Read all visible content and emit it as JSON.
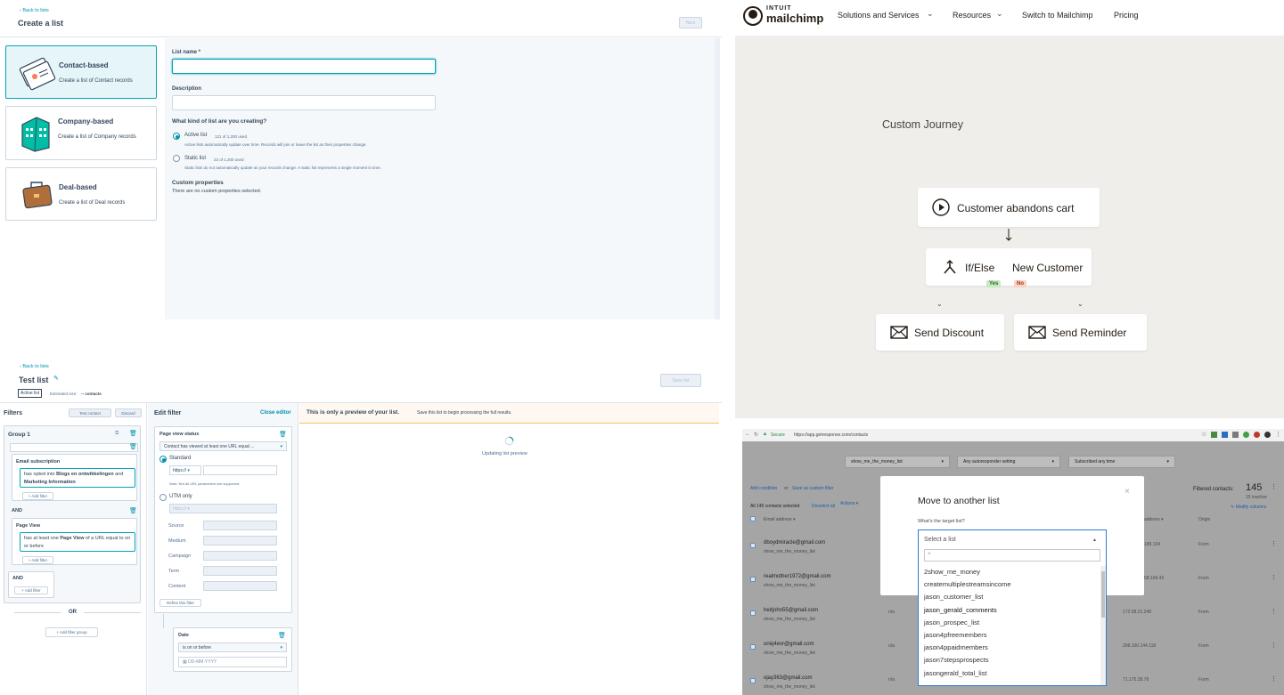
{
  "q1": {
    "back": "‹ Back to lists",
    "title": "Create a list",
    "next": "Next",
    "cards": [
      {
        "name": "Contact-based",
        "desc": "Create a list of Contact records",
        "icon": "contact-cards-icon"
      },
      {
        "name": "Company-based",
        "desc": "Create a list of Company records",
        "icon": "building-icon"
      },
      {
        "name": "Deal-based",
        "desc": "Create a list of Deal records",
        "icon": "briefcase-icon"
      }
    ],
    "list_name_label": "List name *",
    "list_name_value": "",
    "description_label": "Description",
    "description_value": "",
    "kind_question": "What kind of list are you creating?",
    "active_label": "Active list",
    "active_usage": "121 of 1,200 used",
    "active_help": "Active lists automatically update over time. Records will join or leave the list as their properties change.",
    "static_label": "Static list",
    "static_usage": "22 of 1,200 used",
    "static_help": "Static lists do not automatically update as your records change. A static list represents a single moment in time.",
    "custom_props_label": "Custom properties",
    "custom_props_text": "There are no custom properties selected.",
    "accent": "#00a4bd"
  },
  "q2": {
    "brand_top": "INTUIT",
    "brand": "mailchimp",
    "nav": [
      "Solutions and Services",
      "Resources",
      "Switch to Mailchimp",
      "Pricing"
    ],
    "journey_title": "Custom Journey",
    "trigger": "Customer abandons cart",
    "branch": "If/Else",
    "branch_cond": "New Customer",
    "yes": "Yes",
    "no": "No",
    "left_action": "Send Discount",
    "right_action": "Send Reminder",
    "bg": "#efeeea"
  },
  "q3": {
    "back": "‹ Back to lists",
    "title": "Test list",
    "badge": "Active list",
    "estimated": "Estimated size:",
    "estimated_value": "-- contacts",
    "save": "Save list",
    "filters_title": "Filters",
    "test_contact": "Test contact",
    "discard": "Discard",
    "group_name": "Group 1",
    "email_sub": "Email subscription",
    "filter1_a": "has opted into",
    "filter1_b": "Blogs en ontwikkelingen",
    "filter1_c": "and",
    "filter1_d": "Marketing Information",
    "add_filter": "+ Add filter",
    "and": "AND",
    "page_view": "Page View",
    "filter2_a": "has at least one",
    "filter2_b": "Page View",
    "filter2_c": "of a URL equal to",
    "filter2_d": "on or before",
    "or": "OR",
    "add_group": "+ Add filter group",
    "edit_title": "Edit filter",
    "close_editor": "Close editor",
    "pv_status": "Page view status",
    "pv_select": "Contact has viewed at least one URL equal ...",
    "standard": "Standard",
    "https": "https://",
    "note": "Note: Not all URL parameters are supported.",
    "utm": "UTM only",
    "utm_fields": [
      "Source",
      "Medium",
      "Campaign",
      "Term",
      "Content"
    ],
    "refine": "Refine this filter",
    "date_label": "Date",
    "date_op": "is on or before",
    "date_placeholder": "DD-MM-YYYY",
    "preview_bold": "This is only a preview of your list.",
    "preview_rest": "Save this list to begin processing the full results.",
    "updating": "Updating list preview"
  },
  "q4": {
    "secure": "Secure",
    "url": "https://app.getresponse.com/contacts",
    "filter1": "show_me_the_money_list",
    "filter2": "Any autoresponder setting",
    "filter3": "Subscribed any time",
    "add_condition": "Add condition",
    "or": "or",
    "save_filter": "Save as custom filter",
    "filtered_label": "Filtered contacts:",
    "filtered_count": "145",
    "inactive": "15 inactive",
    "selected_text": "All 145 contacts selected",
    "deselect": "Deselect all",
    "actions": "Actions ▾",
    "modify": "✎ Modify columns",
    "col_email": "Email address ▾",
    "col_address": "address ▾",
    "col_origin": "Origin",
    "rows": [
      {
        "email": "dboydmiracle@gmail.com",
        "list": "show_me_the_money_list",
        "na": "",
        "ip": "189.134",
        "origin": "Form"
      },
      {
        "email": "realmother1972@gmail.com",
        "list": "show_me_the_money_list",
        "na": "",
        "ip": "58.169.43",
        "origin": "Form"
      },
      {
        "email": "heitjohn55@gmail.com",
        "list": "show_me_the_money_list",
        "na": "n/a",
        "ip": "172.58.21.248",
        "origin": "Form"
      },
      {
        "email": "uniq4evr@gmail.com",
        "list": "show_me_the_money_list",
        "na": "n/a",
        "ip": "208.100.144.118",
        "origin": "Form"
      },
      {
        "email": "ojay363@gmail.com",
        "list": "show_me_the_money_list",
        "na": "n/a",
        "ip": "71.175.38.78",
        "origin": "Form"
      }
    ],
    "modal_title": "Move to another list",
    "modal_q": "What's the target list?",
    "select_placeholder": "Select a list",
    "options": [
      "2show_me_money",
      "createmultiplestreamsincome",
      "jason_customer_list",
      "jason_gerald_comments",
      "jason_prospec_list",
      "jason4pfreemembers",
      "jason4ppaidmembers",
      "jason7stepsprospects",
      "jasongerald_total_list"
    ]
  }
}
